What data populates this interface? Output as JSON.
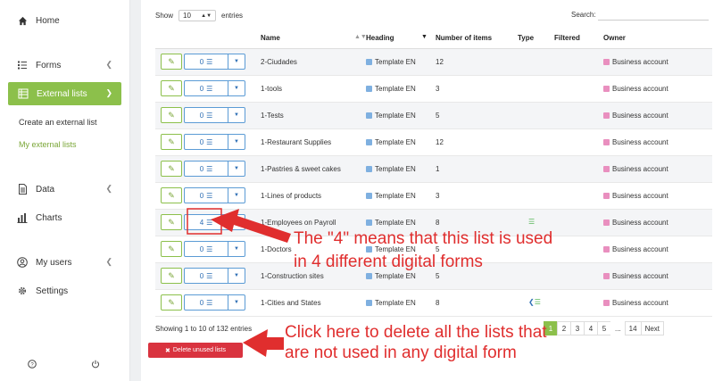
{
  "sidebar": {
    "items": [
      {
        "label": "Home",
        "icon": "home-icon"
      },
      {
        "label": "Forms",
        "icon": "list-icon"
      },
      {
        "label": "External lists",
        "icon": "table-icon"
      },
      {
        "label": "Data",
        "icon": "document-icon"
      },
      {
        "label": "Charts",
        "icon": "bar-chart-icon"
      },
      {
        "label": "My users",
        "icon": "user-icon"
      },
      {
        "label": "Settings",
        "icon": "gear-icon"
      }
    ],
    "subitems": [
      "Create an external list",
      "My external lists"
    ]
  },
  "toolbar": {
    "show_label": "Show",
    "entries_value": "10",
    "entries_label": "entries",
    "search_label": "Search:"
  },
  "table": {
    "headers": [
      "Name",
      "Heading",
      "Number of items",
      "Type",
      "Filtered",
      "Owner"
    ],
    "rows": [
      {
        "count": "0",
        "name": "2-Ciudades",
        "heading": "Template EN",
        "items": "12",
        "type": "",
        "owner": "Business account"
      },
      {
        "count": "0",
        "name": "1-tools",
        "heading": "Template EN",
        "items": "3",
        "type": "",
        "owner": "Business account"
      },
      {
        "count": "0",
        "name": "1-Tests",
        "heading": "Template EN",
        "items": "5",
        "type": "",
        "owner": "Business account"
      },
      {
        "count": "0",
        "name": "1-Restaurant Supplies",
        "heading": "Template EN",
        "items": "12",
        "type": "",
        "owner": "Business account"
      },
      {
        "count": "0",
        "name": "1-Pastries & sweet cakes",
        "heading": "Template EN",
        "items": "1",
        "type": "",
        "owner": "Business account"
      },
      {
        "count": "0",
        "name": "1-Lines of products",
        "heading": "Template EN",
        "items": "3",
        "type": "",
        "owner": "Business account"
      },
      {
        "count": "4",
        "name": "1-Employees on Payroll",
        "heading": "Template EN",
        "items": "8",
        "type": "list",
        "owner": "Business account"
      },
      {
        "count": "0",
        "name": "1-Doctors",
        "heading": "Template EN",
        "items": "5",
        "type": "",
        "owner": "Business account"
      },
      {
        "count": "0",
        "name": "1-Construction sites",
        "heading": "Template EN",
        "items": "5",
        "type": "",
        "owner": "Business account"
      },
      {
        "count": "0",
        "name": "1-Cities and States",
        "heading": "Template EN",
        "items": "8",
        "type": "share-list",
        "owner": "Business account"
      }
    ]
  },
  "footer": {
    "info": "Showing 1 to 10 of 132 entries",
    "pages": [
      "1",
      "2",
      "3",
      "4",
      "5",
      "...",
      "14",
      "Next"
    ],
    "delete_label": "Delete unused lists"
  },
  "annotations": {
    "count_line1": "The \"4\" means that this list is used",
    "count_line2": "in 4 different digital forms",
    "delete_line1": "Click here to delete all the lists that",
    "delete_line2": "are not used in any digital form"
  },
  "colors": {
    "accent_green": "#8cc04b",
    "annotation_red": "#e02e2e",
    "delete_red": "#d9333f",
    "heading_blue": "#7fb0e0",
    "owner_pink": "#e98fbf"
  }
}
